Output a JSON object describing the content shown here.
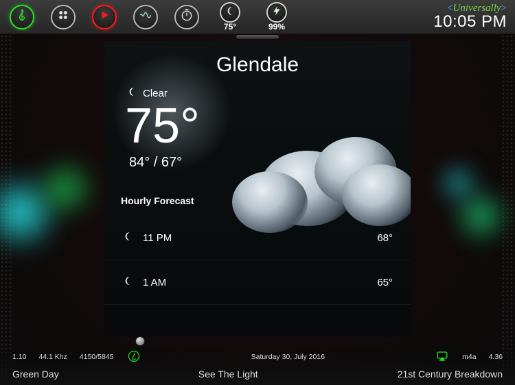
{
  "topbar": {
    "stats": {
      "temp": "75°",
      "battery": "99%"
    },
    "brand": "Universally",
    "clock": "10:05 PM"
  },
  "weather": {
    "location": "Glendale",
    "condition": "Clear",
    "temp": "75°",
    "high": "84°",
    "low": "67°",
    "hilo_sep": " / ",
    "hourly_label": "Hourly Forecast",
    "hours": [
      {
        "time": "11 PM",
        "temp": "68°"
      },
      {
        "time": "1 AM",
        "temp": "65°"
      }
    ]
  },
  "footer": {
    "row1": {
      "elapsed": "1.10",
      "freq": "44.1 Khz",
      "track_index": "4150/5845",
      "date": "Saturday 30, July 2016",
      "format": "m4a",
      "duration": "4.36"
    },
    "row2": {
      "artist": "Green Day",
      "track": "See The Light",
      "album": "21st Century Breakdown"
    }
  }
}
